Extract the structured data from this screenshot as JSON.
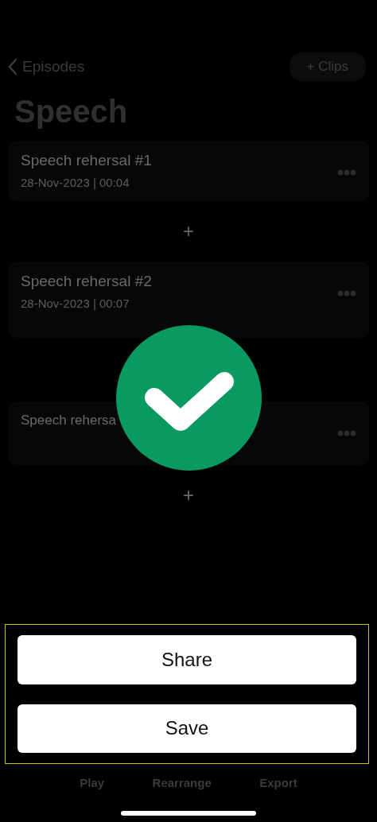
{
  "nav": {
    "back_label": "Episodes",
    "action": "+ Clips"
  },
  "title": "Speech",
  "episodes": [
    {
      "kind": "episode",
      "title": "Speech rehersal #1",
      "meta": "28-Nov-2023 | 00:04"
    },
    {
      "kind": "add",
      "symbol": "+"
    },
    {
      "kind": "episode",
      "title": "Speech rehersal #2",
      "meta": "28-Nov-2023 | 00:07"
    },
    {
      "kind": "episode",
      "title": "Speech rehersa"
    },
    {
      "kind": "add",
      "symbol": "+"
    }
  ],
  "sheet": {
    "buttons": [
      "Share",
      "Save"
    ]
  },
  "tab_bar": [
    {
      "label": "Play"
    },
    {
      "label": "Rearrange"
    },
    {
      "label": "Export"
    }
  ]
}
